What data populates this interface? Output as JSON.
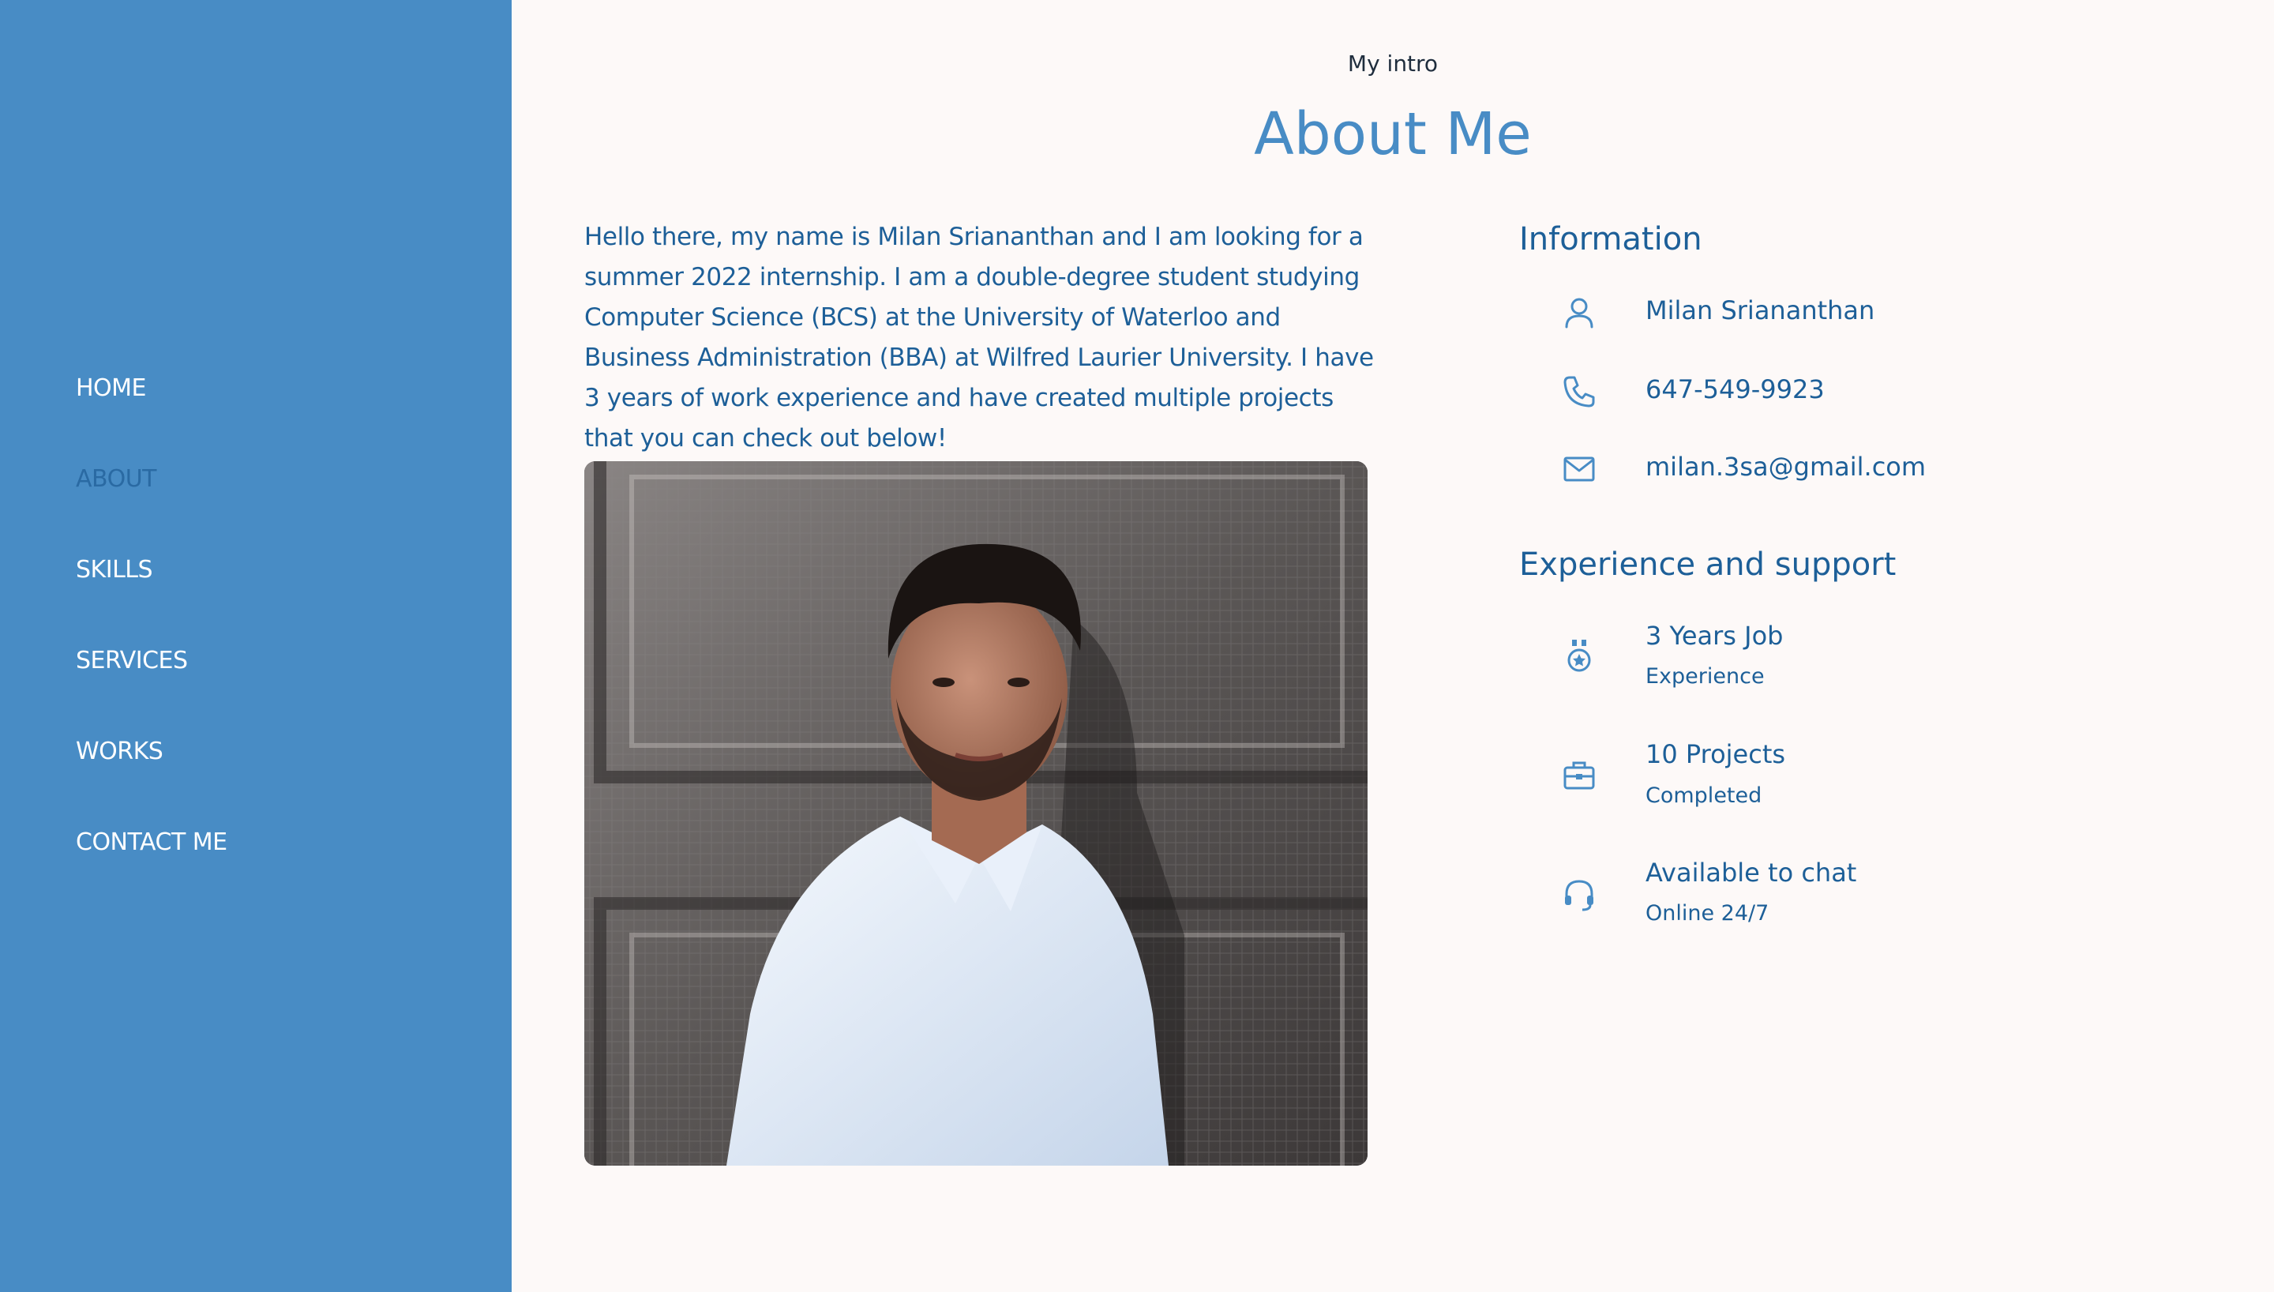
{
  "nav": {
    "items": [
      {
        "label": "HOME",
        "active": false
      },
      {
        "label": "ABOUT",
        "active": true
      },
      {
        "label": "SKILLS",
        "active": false
      },
      {
        "label": "SERVICES",
        "active": false
      },
      {
        "label": "WORKS",
        "active": false
      },
      {
        "label": "CONTACT ME",
        "active": false
      }
    ]
  },
  "header": {
    "subtitle": "My intro",
    "title": "About Me"
  },
  "about": {
    "intro": "Hello there, my name is Milan Sriananthan and I am looking for a summer 2022 internship. I am a double-degree student studying Computer Science (BCS) at the University of Waterloo and Business Administration (BBA) at Wilfred Laurier University. I have 3 years of work experience and have created multiple projects that you can check out below!"
  },
  "information": {
    "heading": "Information",
    "name": "Milan Sriananthan",
    "phone": "647-549-9923",
    "email": "milan.3sa@gmail.com"
  },
  "experience": {
    "heading": "Experience and support",
    "items": [
      {
        "title": "3 Years Job",
        "subtitle": "Experience",
        "icon": "medal-icon"
      },
      {
        "title": "10 Projects",
        "subtitle": "Completed",
        "icon": "briefcase-icon"
      },
      {
        "title": "Available to chat",
        "subtitle": "Online 24/7",
        "icon": "headset-icon"
      }
    ]
  },
  "colors": {
    "sidebar": "#488cc5",
    "accent": "#488cc5",
    "text": "#1d5f98",
    "background": "#fdf9f8",
    "nav_active": "#2a6aa3"
  }
}
